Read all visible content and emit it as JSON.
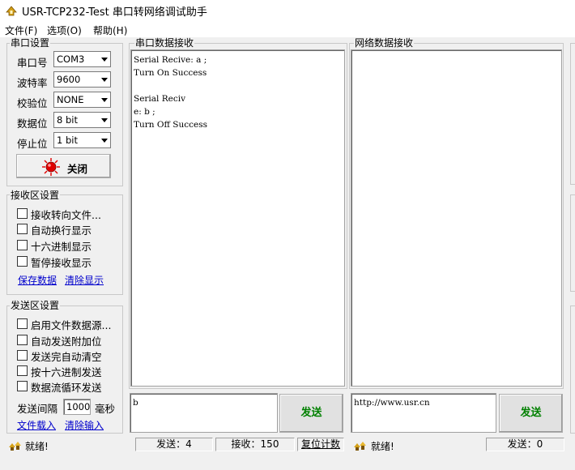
{
  "window": {
    "title": "USR-TCP232-Test 串口转网络调试助手"
  },
  "menu": [
    {
      "label": "文件(F)"
    },
    {
      "label": "选项(O)"
    },
    {
      "label": "帮助(H)"
    }
  ],
  "serial_settings": {
    "title": "串口设置",
    "port_label": "串口号",
    "port_value": "COM3",
    "baud_label": "波特率",
    "baud_value": "9600",
    "parity_label": "校验位",
    "parity_value": "NONE",
    "databits_label": "数据位",
    "databits_value": "8 bit",
    "stopbits_label": "停止位",
    "stopbits_value": "1 bit",
    "close_button": "关闭"
  },
  "receive_settings": {
    "title": "接收区设置",
    "options": [
      {
        "label": "接收转向文件..."
      },
      {
        "label": "自动换行显示"
      },
      {
        "label": "十六进制显示"
      },
      {
        "label": "暂停接收显示"
      }
    ],
    "save_link": "保存数据",
    "clear_link": "清除显示"
  },
  "send_settings": {
    "title": "发送区设置",
    "options": [
      {
        "label": "启用文件数据源..."
      },
      {
        "label": "自动发送附加位"
      },
      {
        "label": "发送完自动清空"
      },
      {
        "label": "按十六进制发送"
      },
      {
        "label": "数据流循环发送"
      }
    ],
    "interval_label": "发送间隔",
    "interval_value": "1000",
    "interval_unit": "毫秒",
    "load_link": "文件载入",
    "clear_link": "清除输入"
  },
  "serial_receive": {
    "title": "串口数据接收",
    "content": "Serial Recive: a ;\nTurn On Success\n\nSerial Reciv\ne: b ;\nTurn Off Success"
  },
  "network_receive": {
    "title": "网络数据接收",
    "content": ""
  },
  "serial_send": {
    "input": "b",
    "send_button": "发送"
  },
  "network_send": {
    "input": "http://www.usr.cn",
    "send_button": "发送"
  },
  "status_bar": {
    "left_status": "就绪!",
    "send_count": "发送：4",
    "receive_count": "接收：150",
    "reset_button": "复位计数",
    "right_status": "就绪!",
    "right_send_count": "发送：0"
  },
  "colors": {
    "indicator_red": "#e00000",
    "send_green": "#008000"
  }
}
